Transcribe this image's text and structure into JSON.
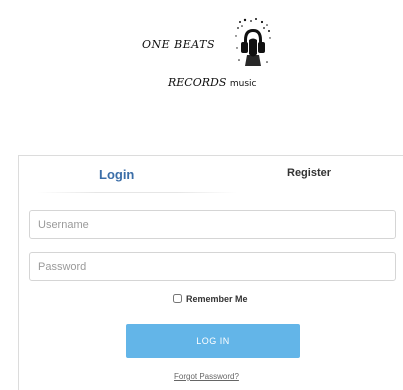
{
  "logo": {
    "line1": "ONE BEATS",
    "line2": "RECORDS",
    "line2_suffix": "music",
    "icon": "headphones-figure-icon"
  },
  "tabs": [
    {
      "label": "Login",
      "active": true
    },
    {
      "label": "Register",
      "active": false
    }
  ],
  "form": {
    "username_placeholder": "Username",
    "password_placeholder": "Password",
    "remember_label": "Remember Me",
    "login_label": "LOG IN",
    "forgot_label": "Forgot Password?"
  },
  "colors": {
    "accent": "#3b6ea8",
    "button": "#63b5e8"
  }
}
